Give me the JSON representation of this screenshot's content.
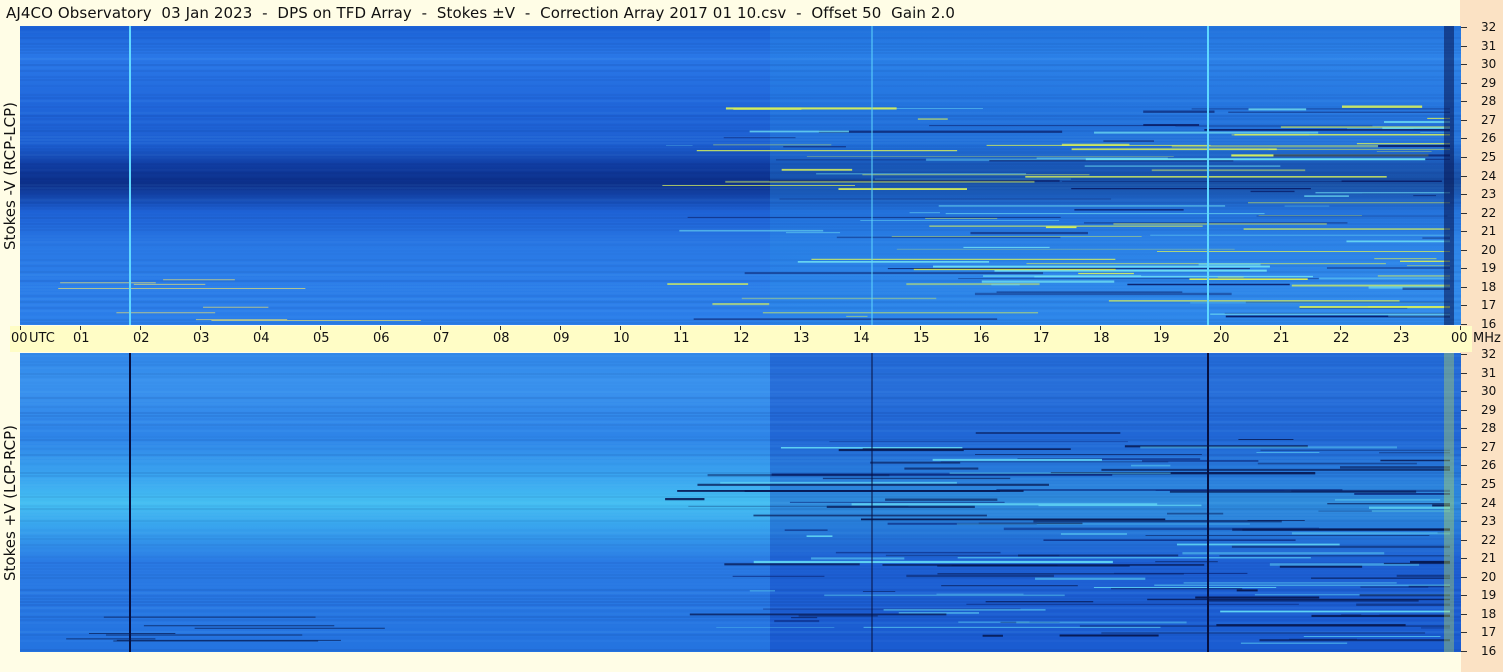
{
  "title": "AJ4CO Observatory  03 Jan 2023  -  DPS on TFD Array  -  Stokes ±V  -  Correction Array 2017 01 10.csv  -  Offset 50  Gain 2.0",
  "panels": {
    "top_label": "Stokes -V (RCP-LCP)",
    "bottom_label": "Stokes +V (LCP-RCP)"
  },
  "time_axis": {
    "labels": [
      "00",
      "UTC",
      "01",
      "02",
      "03",
      "04",
      "05",
      "06",
      "07",
      "08",
      "09",
      "10",
      "11",
      "12",
      "13",
      "14",
      "15",
      "16",
      "17",
      "18",
      "19",
      "20",
      "21",
      "22",
      "23",
      "00",
      "MHz"
    ]
  },
  "chart_data": {
    "type": "heatmap",
    "title": "AJ4CO Observatory  03 Jan 2023  -  DPS on TFD Array  -  Stokes ±V  -  Correction Array 2017 01 10.csv  -  Offset 50  Gain 2.0",
    "x_ticks": [
      "00",
      "01",
      "02",
      "03",
      "04",
      "05",
      "06",
      "07",
      "08",
      "09",
      "10",
      "11",
      "12",
      "13",
      "14",
      "15",
      "16",
      "17",
      "18",
      "19",
      "20",
      "21",
      "22",
      "23",
      "00"
    ],
    "x_unit": "UTC",
    "y_ticks": [
      "32",
      "31",
      "30",
      "29",
      "28",
      "27",
      "26",
      "25",
      "24",
      "23",
      "22",
      "21",
      "20",
      "19",
      "18",
      "17",
      "16"
    ],
    "y_unit": "MHz",
    "xlim": [
      0,
      24
    ],
    "ylim": [
      16,
      32
    ],
    "series": [
      {
        "name": "Stokes -V (RCP-LCP)"
      },
      {
        "name": "Stokes +V (LCP-RCP)"
      }
    ]
  },
  "colors": {
    "background": "#fffde6",
    "axis_band": "#fffdc6",
    "right_strip": "#fbe2c4",
    "spectrum_low": "#0c2f88",
    "spectrum_mid": "#2a78e8",
    "spectrum_high": "#45bff2",
    "rfi_high": "#d8f05a"
  }
}
